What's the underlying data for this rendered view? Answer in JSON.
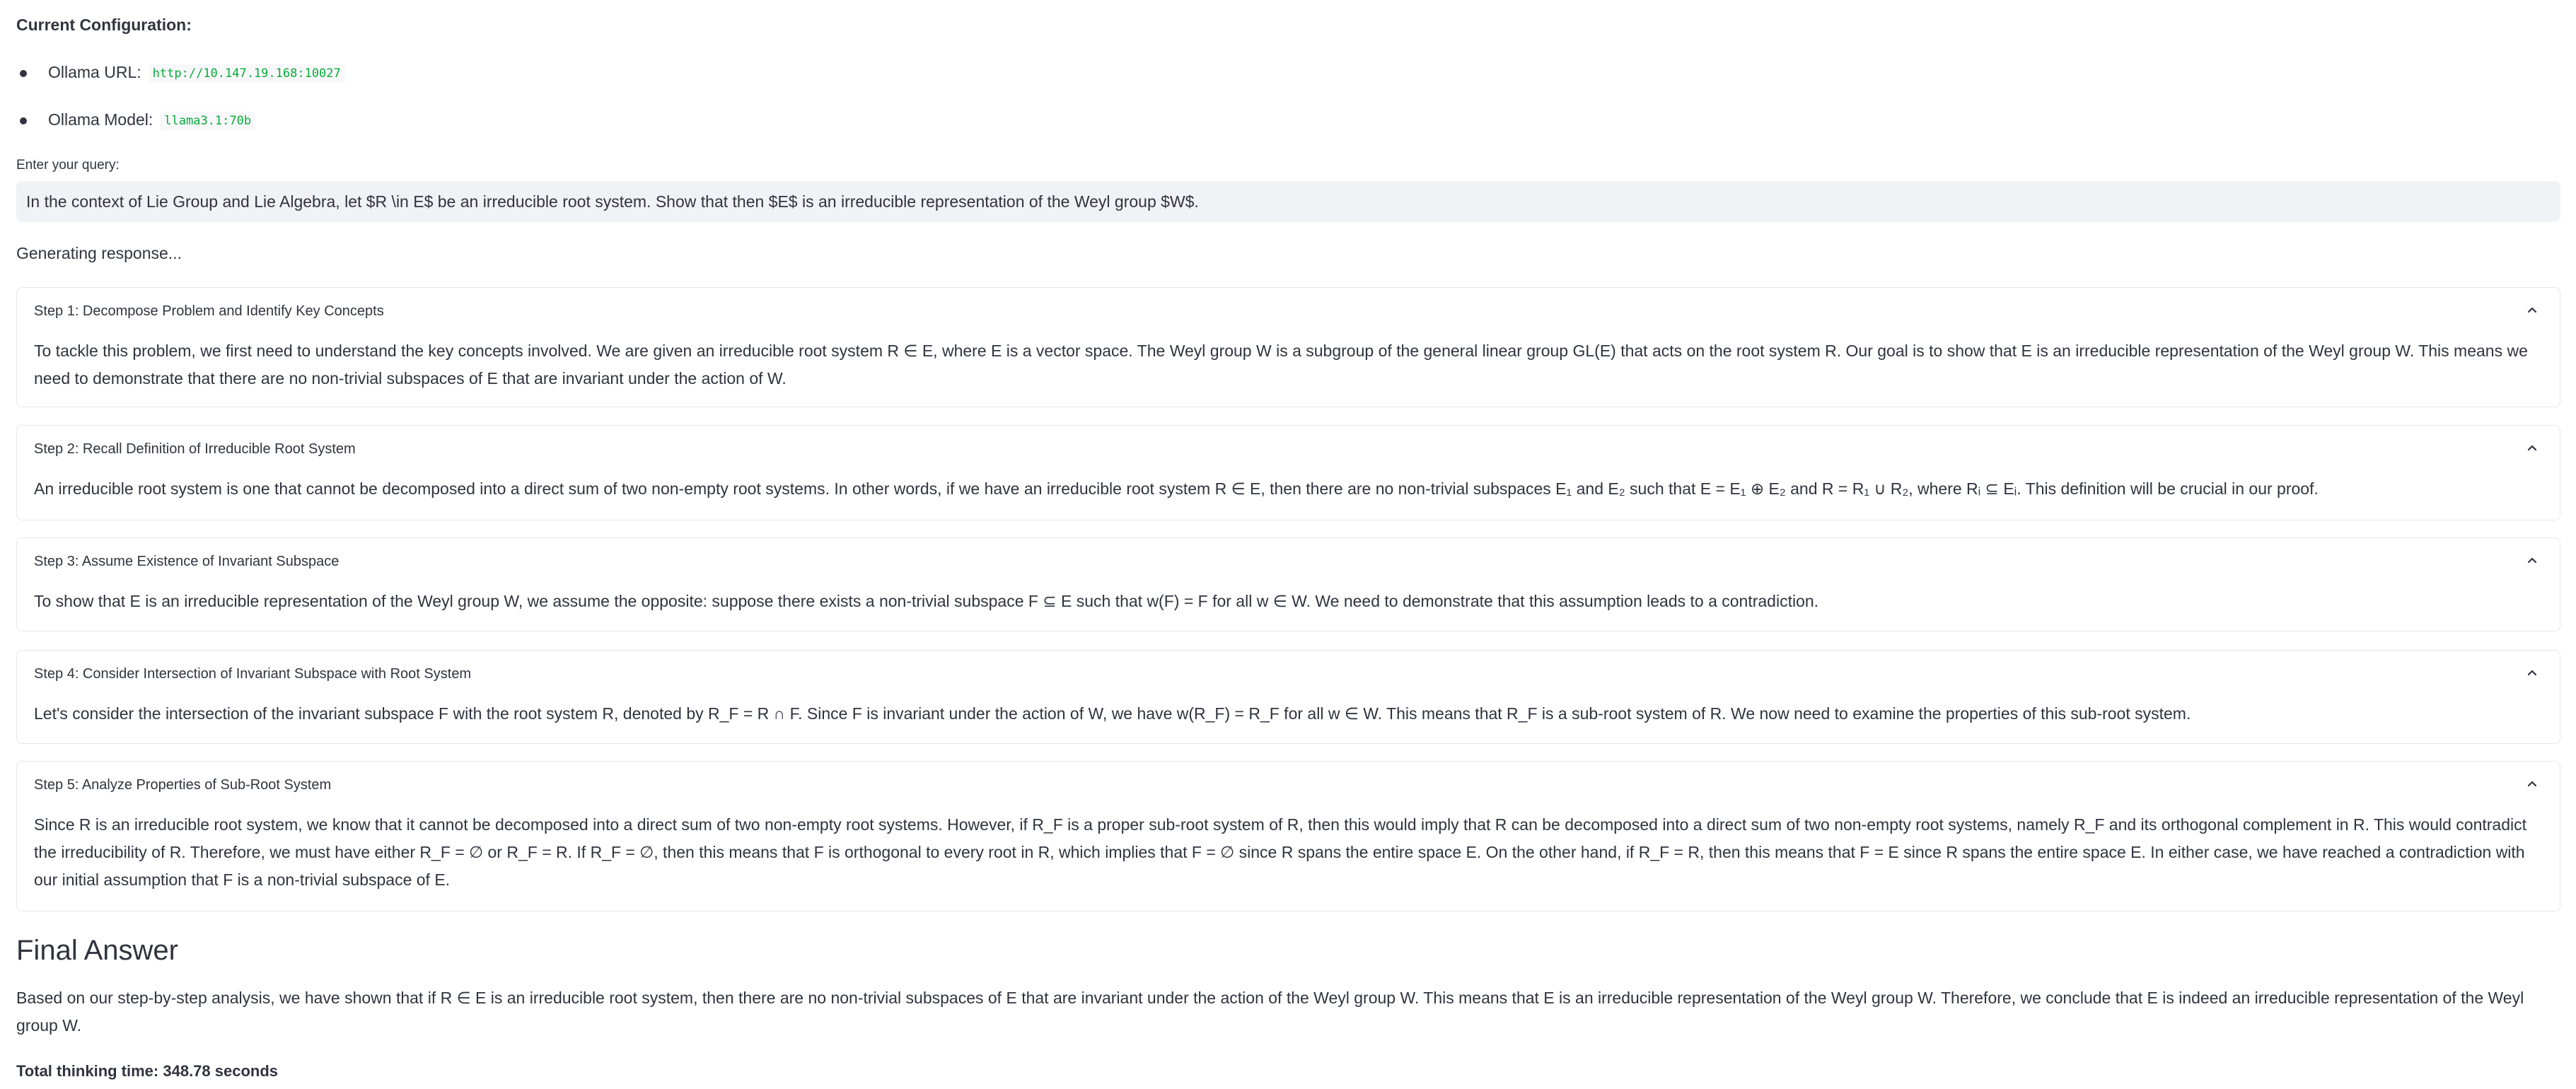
{
  "config": {
    "title": "Current Configuration:",
    "items": [
      {
        "label": "Ollama URL:",
        "value": "http://10.147.19.168:10027"
      },
      {
        "label": "Ollama Model:",
        "value": "llama3.1:70b"
      }
    ]
  },
  "query": {
    "label": "Enter your query:",
    "value": "In the context of Lie Group and Lie Algebra, let $R \\in E$ be an irreducible root system. Show that then $E$ is an irreducible representation of the Weyl group $W$."
  },
  "status": "Generating response...",
  "steps": [
    {
      "title": "Step 1: Decompose Problem and Identify Key Concepts",
      "body": "To tackle this problem, we first need to understand the key concepts involved. We are given an irreducible root system R ∈ E, where E is a vector space. The Weyl group W is a subgroup of the general linear group GL(E) that acts on the root system R. Our goal is to show that E is an irreducible representation of the Weyl group W. This means we need to demonstrate that there are no non-trivial subspaces of E that are invariant under the action of W."
    },
    {
      "title": "Step 2: Recall Definition of Irreducible Root System",
      "body": "An irreducible root system is one that cannot be decomposed into a direct sum of two non-empty root systems. In other words, if we have an irreducible root system R ∈ E, then there are no non-trivial subspaces E₁ and E₂ such that E = E₁ ⊕ E₂ and R = R₁ ∪ R₂, where Rᵢ ⊆ Eᵢ. This definition will be crucial in our proof."
    },
    {
      "title": "Step 3: Assume Existence of Invariant Subspace",
      "body": "To show that E is an irreducible representation of the Weyl group W, we assume the opposite: suppose there exists a non-trivial subspace F ⊆ E such that w(F) = F for all w ∈ W. We need to demonstrate that this assumption leads to a contradiction."
    },
    {
      "title": "Step 4: Consider Intersection of Invariant Subspace with Root System",
      "body": "Let's consider the intersection of the invariant subspace F with the root system R, denoted by R_F = R ∩ F. Since F is invariant under the action of W, we have w(R_F) = R_F for all w ∈ W. This means that R_F is a sub-root system of R. We now need to examine the properties of this sub-root system."
    },
    {
      "title": "Step 5: Analyze Properties of Sub-Root System",
      "body": "Since R is an irreducible root system, we know that it cannot be decomposed into a direct sum of two non-empty root systems. However, if R_F is a proper sub-root system of R, then this would imply that R can be decomposed into a direct sum of two non-empty root systems, namely R_F and its orthogonal complement in R. This would contradict the irreducibility of R. Therefore, we must have either R_F = ∅ or R_F = R. If R_F = ∅, then this means that F is orthogonal to every root in R, which implies that F = ∅ since R spans the entire space E. On the other hand, if R_F = R, then this means that F = E since R spans the entire space E. In either case, we have reached a contradiction with our initial assumption that F is a non-trivial subspace of E."
    }
  ],
  "final": {
    "title": "Final Answer",
    "body": "Based on our step-by-step analysis, we have shown that if R ∈ E is an irreducible root system, then there are no non-trivial subspaces of E that are invariant under the action of the Weyl group W. This means that E is an irreducible representation of the Weyl group W. Therefore, we conclude that E is indeed an irreducible representation of the Weyl group W."
  },
  "total_time": "Total thinking time: 348.78 seconds",
  "icons": {
    "expander_chevron": "chevron-up-icon"
  }
}
